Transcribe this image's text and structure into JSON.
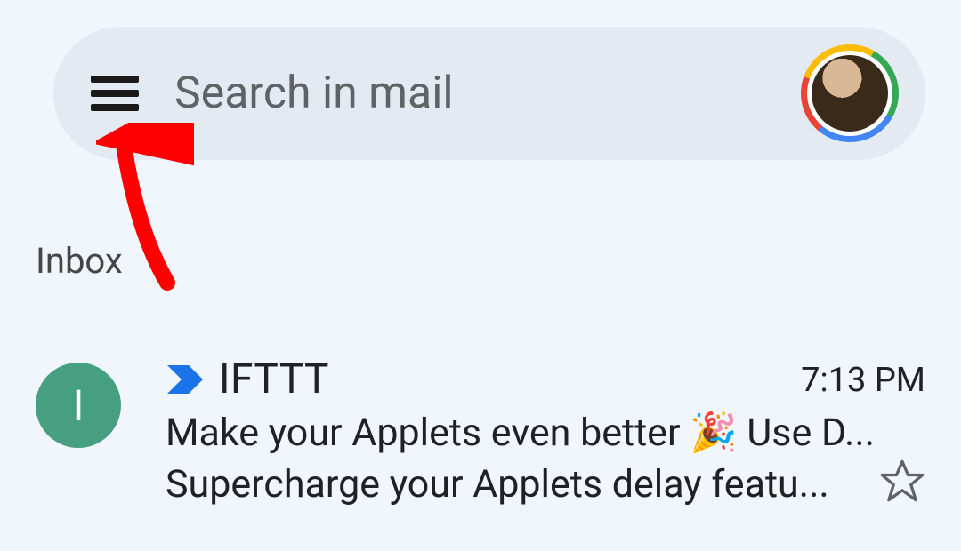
{
  "search": {
    "placeholder": "Search in mail"
  },
  "section_label": "Inbox",
  "mail": {
    "sender_initial": "I",
    "sender": "IFTTT",
    "time": "7:13 PM",
    "subject": "Make your Applets even better 🎉 Use D...",
    "snippet": "Supercharge your Applets   delay featu..."
  },
  "colors": {
    "app_bg": "#f1f6fc",
    "searchbar_bg": "#e4eaf1",
    "sender_circle": "#479f82",
    "importance": "#1a73e8",
    "annotation": "#ff0000"
  }
}
